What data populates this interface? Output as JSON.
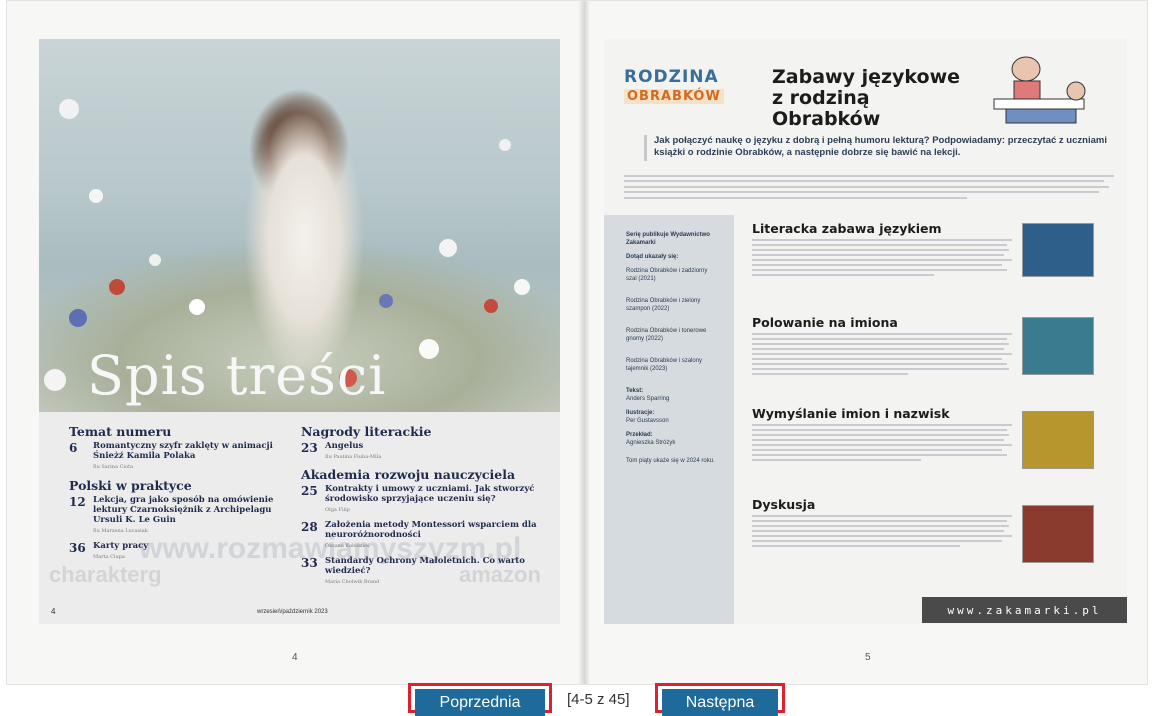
{
  "left_page": {
    "cover_title": "Spis treści",
    "page_number": "4",
    "footer_number": "4",
    "footer_date": "wrzesień/październik 2023",
    "watermark": "www.rozmawiamyszyzm.pl",
    "watermark_bottom_left": "charakterg",
    "watermark_bottom_right": "amazon",
    "toc_left": {
      "section1": "Temat numeru",
      "items1": [
        {
          "num": "6",
          "text": "Romantyczny szyfr zaklęty w animacji Śnieżź Kamila Polaka",
          "author": "Ilu Sarina Ciota"
        }
      ],
      "section2": "Polski w praktyce",
      "items2": [
        {
          "num": "12",
          "text": "Lekcja, gra jako sposób na omówienie lektury Czarnoksiężnik z Archipelagu Ursuli K. Le Guin",
          "author": "Ilu Marzena Lucasiak"
        },
        {
          "num": "36",
          "text": "Karty pracy",
          "author": "Marta Ciupa"
        }
      ]
    },
    "toc_right": {
      "section1": "Nagrody literackie",
      "items1": [
        {
          "num": "23",
          "text": "Angelus",
          "author": "Ilu Paulina Fiuba-Mila"
        }
      ],
      "section2": "Akademia rozwoju nauczyciela",
      "items2": [
        {
          "num": "25",
          "text": "Kontrakty i umowy z uczniami. Jak stworzyć środowisko sprzyjające uczeniu się?",
          "author": "Olga Filip"
        },
        {
          "num": "28",
          "text": "Założenia metody Montessori wsparciem dla neuroróżnorodności",
          "author": "Oksana Kołodzieś"
        },
        {
          "num": "33",
          "text": "Standardy Ochrony Małoletnich. Co warto wiedzieć?",
          "author": "Maria Cholwik Brand"
        }
      ]
    }
  },
  "right_page": {
    "logo_top": "RODZINA",
    "logo_bottom": "OBRABKÓW",
    "title": "Zabawy językowe z rodziną Obrabków",
    "intro": "Jak połączyć naukę o języku z dobrą i pełną humoru lekturą? Podpowiadamy: przeczytać z uczniami książki o rodzinie Obrabków, a następnie dobrze się bawić na lekcji.",
    "sidebar": {
      "series": "Serię publikuje Wydawnictwo Zakamarki",
      "so_far": "Dotąd ukazały się:",
      "books": [
        "Rodzina Obrabków i zadziorny szal (2021)",
        "Rodzina Obrabków i zielony szampon (2022)",
        "Rodzina Obrabków i tonerowe gnomy (2022)",
        "Rodzina Obrabków i szalony tajemnik (2023)"
      ],
      "text_label": "Tekst:",
      "text_author": "Anders Sparring",
      "ill_label": "Ilustracje:",
      "ill_author": "Per Gustavsson",
      "tr_label": "Przekład:",
      "tr_author": "Agnieszka Stróżyk",
      "next_part": "Tom piąty ukaże się w 2024 roku."
    },
    "sections": [
      "Literacka zabawa językiem",
      "Polowanie na imiona",
      "Wymyślanie imion i nazwisk",
      "Dyskusja"
    ],
    "url": "www.zakamarki.pl",
    "footer_number": "5"
  },
  "nav": {
    "prev_label": "Poprzednia",
    "counter": "[4-5 z 45]",
    "next_label": "Następna"
  },
  "colors": {
    "nav_button": "#1e6a9a",
    "highlight_border": "#e0202e",
    "toc_text": "#1f2a4d"
  }
}
